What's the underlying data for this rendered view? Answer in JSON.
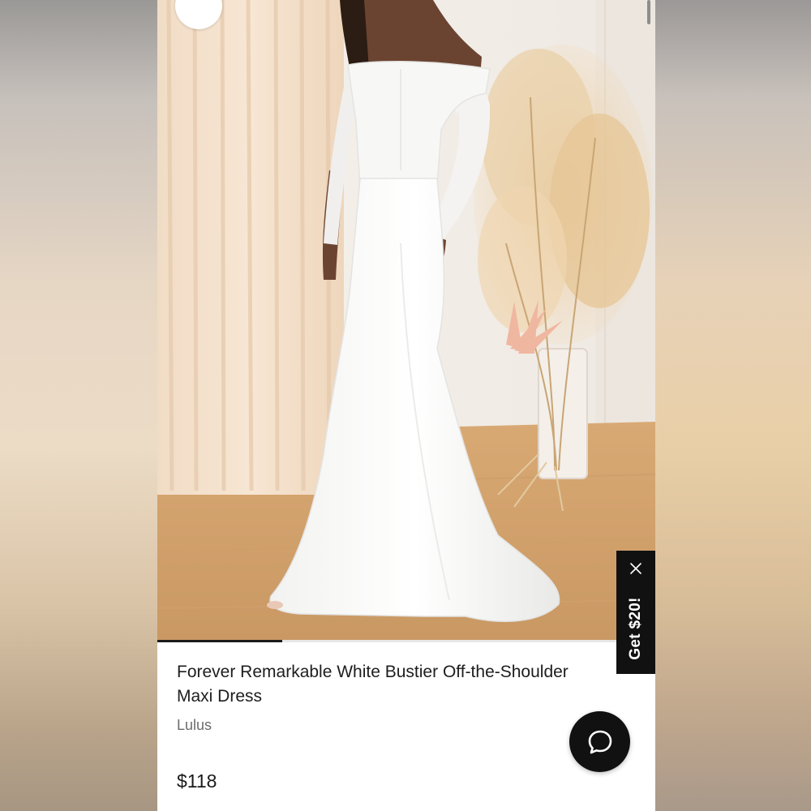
{
  "product": {
    "title": "Forever Remarkable White Bustier Off-the-Shoulder Maxi Dress",
    "brand": "Lulus",
    "price": "$118"
  },
  "gallery": {
    "progress": 0.25,
    "expand_icon": "expand-arrows-icon"
  },
  "promo": {
    "label": "Get $20!",
    "close_icon": "close-icon"
  },
  "chat": {
    "icon": "chat-bubble-icon"
  },
  "colors": {
    "accent": "#111111",
    "text": "#1d1d1d",
    "muted": "#6d6d6d"
  }
}
